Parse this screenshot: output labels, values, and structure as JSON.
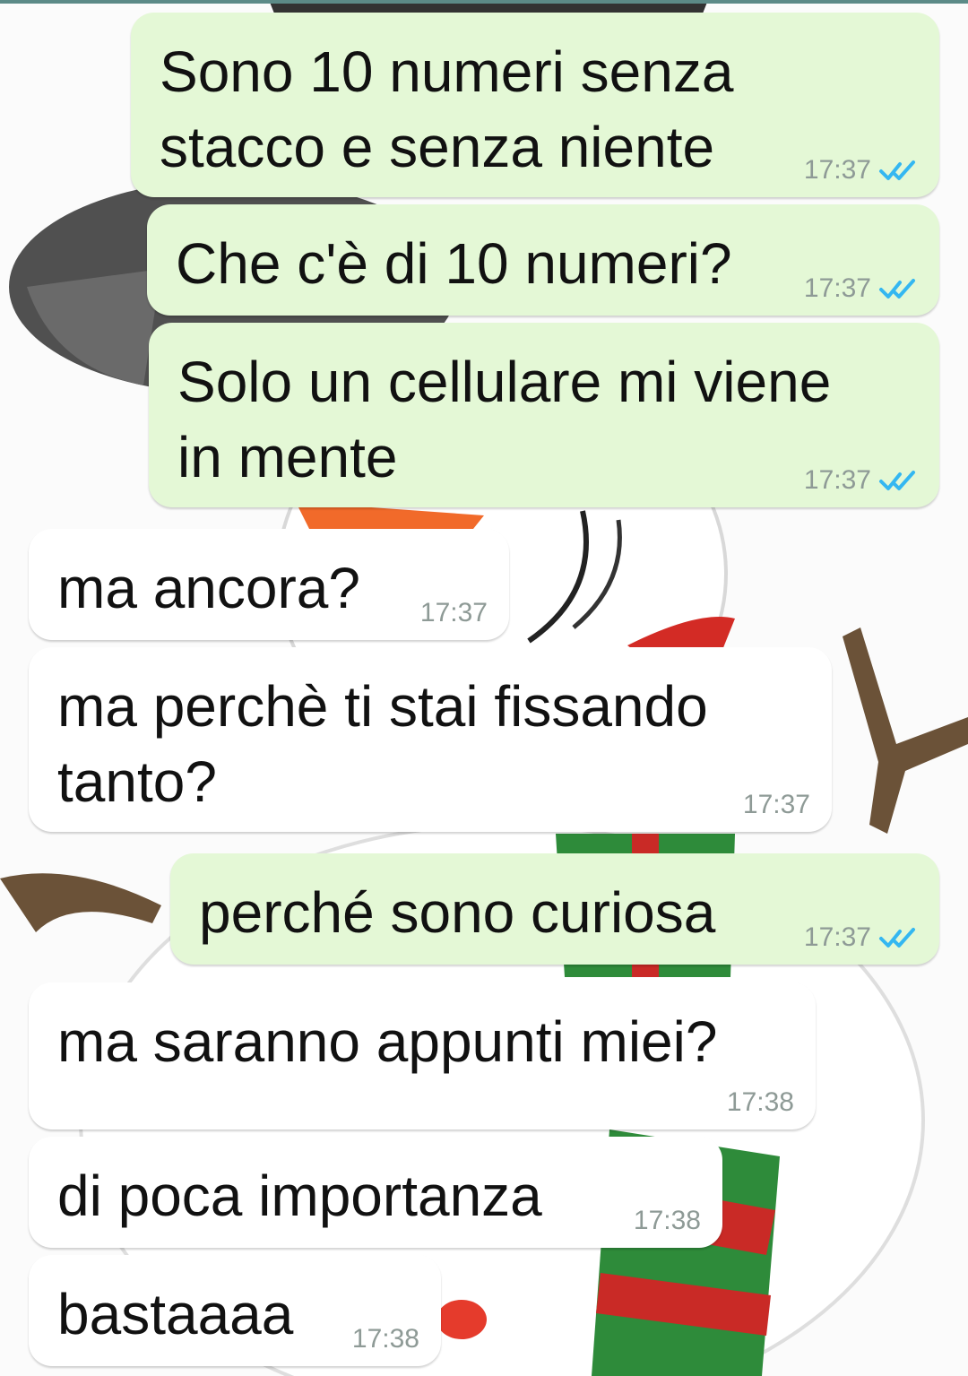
{
  "chat": {
    "wallpaper": "snowman-wallpaper",
    "colors": {
      "outgoing_bubble": "#e4f8d6",
      "incoming_bubble": "#ffffff",
      "read_ticks": "#34b7f1",
      "timestamp": "#8e9a96"
    },
    "messages": [
      {
        "direction": "outgoing",
        "text": "Sono 10 numeri senza\nstacco e senza niente",
        "time": "17:37",
        "status": "read",
        "status_icon": "double-check-icon"
      },
      {
        "direction": "outgoing",
        "text": "Che c'è di 10 numeri?",
        "time": "17:37",
        "status": "read",
        "status_icon": "double-check-icon"
      },
      {
        "direction": "outgoing",
        "text": "Solo un cellulare mi viene\nin mente",
        "time": "17:37",
        "status": "read",
        "status_icon": "double-check-icon"
      },
      {
        "direction": "incoming",
        "text": "ma ancora?",
        "time": "17:37"
      },
      {
        "direction": "incoming",
        "text": "ma perchè ti stai fissando\ntanto?",
        "time": "17:37"
      },
      {
        "direction": "outgoing",
        "text": "perché sono curiosa",
        "time": "17:37",
        "status": "read",
        "status_icon": "double-check-icon"
      },
      {
        "direction": "incoming",
        "text": "ma saranno appunti miei?",
        "time": "17:38"
      },
      {
        "direction": "incoming",
        "text": "di poca importanza",
        "time": "17:38"
      },
      {
        "direction": "incoming",
        "text": "bastaaaa",
        "time": "17:38"
      }
    ]
  }
}
